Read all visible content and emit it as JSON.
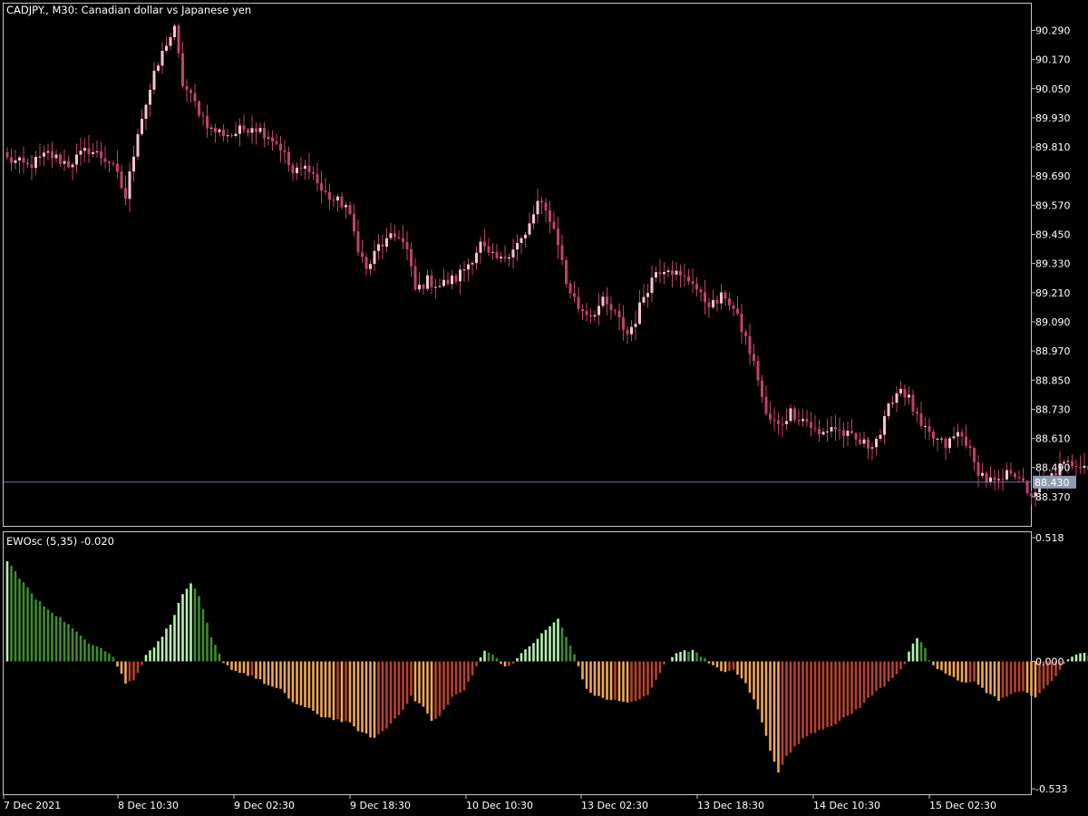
{
  "colors": {
    "background": "#000000",
    "frame": "#c8c8c8",
    "text": "#ffffff",
    "candle_bear": "#c2406b",
    "candle_bull": "#f3c4cf",
    "candle_wick": "#c2406b",
    "bid_line": "#6f7da0",
    "price_label_bg": "#8e9db2",
    "osc_pos_rising": "#b6f0b0",
    "osc_pos_falling": "#3f8a2c",
    "osc_neg_falling": "#f0a850",
    "osc_neg_rising": "#b6422d"
  },
  "chart_data": [
    {
      "type": "candlestick",
      "title": "CADJPY., M30:  Canadian dollar vs Japanese yen",
      "ylim": [
        88.25,
        90.4
      ],
      "y_ticks": [
        "90.290",
        "90.170",
        "90.050",
        "89.930",
        "89.810",
        "89.690",
        "89.570",
        "89.450",
        "89.330",
        "89.210",
        "89.090",
        "88.970",
        "88.850",
        "88.730",
        "88.610",
        "88.490",
        "88.370"
      ],
      "current_price": "88.430",
      "x_ticks": [
        "7 Dec 2021",
        "8 Dec 10:30",
        "9 Dec 02:30",
        "9 Dec 18:30",
        "10 Dec 10:30",
        "13 Dec 02:30",
        "13 Dec 18:30",
        "14 Dec 10:30",
        "15 Dec 02:30"
      ],
      "close_anchors": [
        [
          0,
          89.76
        ],
        [
          5,
          89.73
        ],
        [
          10,
          89.78
        ],
        [
          15,
          89.74
        ],
        [
          20,
          89.8
        ],
        [
          25,
          89.75
        ],
        [
          27,
          89.69
        ],
        [
          29,
          89.6
        ],
        [
          32,
          89.88
        ],
        [
          36,
          90.1
        ],
        [
          39,
          90.24
        ],
        [
          41,
          90.29
        ],
        [
          43,
          90.07
        ],
        [
          47,
          89.96
        ],
        [
          50,
          89.88
        ],
        [
          55,
          89.86
        ],
        [
          60,
          89.9
        ],
        [
          64,
          89.86
        ],
        [
          67,
          89.81
        ],
        [
          70,
          89.7
        ],
        [
          74,
          89.73
        ],
        [
          77,
          89.63
        ],
        [
          80,
          89.59
        ],
        [
          83,
          89.57
        ],
        [
          86,
          89.4
        ],
        [
          88,
          89.3
        ],
        [
          91,
          89.4
        ],
        [
          94,
          89.43
        ],
        [
          96,
          89.45
        ],
        [
          98,
          89.38
        ],
        [
          100,
          89.22
        ],
        [
          103,
          89.26
        ],
        [
          106,
          89.24
        ],
        [
          110,
          89.27
        ],
        [
          113,
          89.33
        ],
        [
          116,
          89.41
        ],
        [
          118,
          89.36
        ],
        [
          121,
          89.34
        ],
        [
          124,
          89.4
        ],
        [
          127,
          89.44
        ],
        [
          130,
          89.58
        ],
        [
          133,
          89.52
        ],
        [
          135,
          89.42
        ],
        [
          137,
          89.25
        ],
        [
          140,
          89.15
        ],
        [
          143,
          89.12
        ],
        [
          146,
          89.17
        ],
        [
          149,
          89.12
        ],
        [
          152,
          89.04
        ],
        [
          154,
          89.1
        ],
        [
          156,
          89.2
        ],
        [
          159,
          89.3
        ],
        [
          162,
          89.32
        ],
        [
          165,
          89.27
        ],
        [
          168,
          89.26
        ],
        [
          170,
          89.19
        ],
        [
          173,
          89.16
        ],
        [
          176,
          89.2
        ],
        [
          178,
          89.14
        ],
        [
          181,
          89.02
        ],
        [
          184,
          88.86
        ],
        [
          186,
          88.7
        ],
        [
          189,
          88.66
        ],
        [
          192,
          88.72
        ],
        [
          196,
          88.68
        ],
        [
          199,
          88.62
        ],
        [
          202,
          88.66
        ],
        [
          205,
          88.63
        ],
        [
          208,
          88.6
        ],
        [
          211,
          88.58
        ],
        [
          214,
          88.63
        ],
        [
          217,
          88.78
        ],
        [
          219,
          88.82
        ],
        [
          221,
          88.77
        ],
        [
          224,
          88.65
        ],
        [
          227,
          88.61
        ],
        [
          230,
          88.58
        ],
        [
          233,
          88.63
        ],
        [
          235,
          88.6
        ],
        [
          237,
          88.5
        ],
        [
          240,
          88.44
        ],
        [
          243,
          88.42
        ],
        [
          246,
          88.48
        ],
        [
          248,
          88.46
        ],
        [
          250,
          88.37
        ],
        [
          253,
          88.41
        ],
        [
          255,
          88.44
        ],
        [
          258,
          88.49
        ],
        [
          261,
          88.51
        ],
        [
          264,
          88.51
        ],
        [
          266,
          88.47
        ],
        [
          269,
          88.42
        ],
        [
          272,
          88.38
        ],
        [
          275,
          88.4
        ],
        [
          278,
          88.37
        ],
        [
          281,
          88.42
        ],
        [
          283,
          88.44
        ]
      ]
    },
    {
      "type": "bar",
      "title": "EWOsc (5,35) -0.020",
      "ylim": [
        -0.533,
        0.518
      ],
      "y_ticks": [
        "0.518",
        "0.000",
        "-0.533"
      ],
      "value_anchors": [
        [
          0,
          0.42
        ],
        [
          4,
          0.33
        ],
        [
          7,
          0.26
        ],
        [
          10,
          0.22
        ],
        [
          14,
          0.17
        ],
        [
          17,
          0.12
        ],
        [
          20,
          0.08
        ],
        [
          23,
          0.06
        ],
        [
          26,
          0.02
        ],
        [
          27,
          -0.02
        ],
        [
          29,
          -0.09
        ],
        [
          31,
          -0.08
        ],
        [
          33,
          -0.01
        ],
        [
          34,
          0.03
        ],
        [
          37,
          0.08
        ],
        [
          40,
          0.16
        ],
        [
          43,
          0.28
        ],
        [
          45,
          0.33
        ],
        [
          47,
          0.27
        ],
        [
          50,
          0.1
        ],
        [
          52,
          0.03
        ],
        [
          53,
          -0.01
        ],
        [
          56,
          -0.04
        ],
        [
          60,
          -0.06
        ],
        [
          64,
          -0.1
        ],
        [
          67,
          -0.12
        ],
        [
          70,
          -0.17
        ],
        [
          74,
          -0.2
        ],
        [
          77,
          -0.23
        ],
        [
          80,
          -0.24
        ],
        [
          84,
          -0.26
        ],
        [
          87,
          -0.3
        ],
        [
          90,
          -0.32
        ],
        [
          93,
          -0.28
        ],
        [
          96,
          -0.22
        ],
        [
          99,
          -0.15
        ],
        [
          102,
          -0.19
        ],
        [
          104,
          -0.25
        ],
        [
          106,
          -0.23
        ],
        [
          109,
          -0.15
        ],
        [
          112,
          -0.12
        ],
        [
          114,
          -0.06
        ],
        [
          115,
          -0.02
        ],
        [
          117,
          0.05
        ],
        [
          119,
          0.03
        ],
        [
          121,
          -0.01
        ],
        [
          123,
          -0.02
        ],
        [
          126,
          0.03
        ],
        [
          129,
          0.08
        ],
        [
          132,
          0.13
        ],
        [
          135,
          0.18
        ],
        [
          137,
          0.1
        ],
        [
          139,
          0.03
        ],
        [
          140,
          -0.02
        ],
        [
          142,
          -0.12
        ],
        [
          145,
          -0.15
        ],
        [
          148,
          -0.16
        ],
        [
          151,
          -0.17
        ],
        [
          154,
          -0.17
        ],
        [
          157,
          -0.14
        ],
        [
          159,
          -0.08
        ],
        [
          161,
          -0.01
        ],
        [
          163,
          0.02
        ],
        [
          166,
          0.05
        ],
        [
          169,
          0.04
        ],
        [
          171,
          0.01
        ],
        [
          172,
          -0.01
        ],
        [
          175,
          -0.04
        ],
        [
          178,
          -0.04
        ],
        [
          181,
          -0.09
        ],
        [
          184,
          -0.2
        ],
        [
          187,
          -0.37
        ],
        [
          189,
          -0.46
        ],
        [
          191,
          -0.4
        ],
        [
          194,
          -0.34
        ],
        [
          197,
          -0.3
        ],
        [
          200,
          -0.28
        ],
        [
          203,
          -0.26
        ],
        [
          206,
          -0.23
        ],
        [
          209,
          -0.19
        ],
        [
          212,
          -0.14
        ],
        [
          215,
          -0.1
        ],
        [
          218,
          -0.05
        ],
        [
          220,
          -0.01
        ],
        [
          221,
          0.04
        ],
        [
          223,
          0.1
        ],
        [
          225,
          0.05
        ],
        [
          226,
          0.0
        ],
        [
          228,
          -0.03
        ],
        [
          231,
          -0.06
        ],
        [
          234,
          -0.09
        ],
        [
          237,
          -0.08
        ],
        [
          240,
          -0.13
        ],
        [
          243,
          -0.16
        ],
        [
          246,
          -0.14
        ],
        [
          249,
          -0.12
        ],
        [
          252,
          -0.15
        ],
        [
          254,
          -0.12
        ],
        [
          257,
          -0.06
        ],
        [
          259,
          -0.01
        ],
        [
          262,
          0.03
        ],
        [
          264,
          0.04
        ],
        [
          266,
          0.01
        ],
        [
          268,
          -0.02
        ],
        [
          271,
          -0.05
        ],
        [
          274,
          -0.06
        ],
        [
          277,
          -0.06
        ],
        [
          280,
          -0.04
        ],
        [
          283,
          -0.02
        ]
      ]
    }
  ]
}
